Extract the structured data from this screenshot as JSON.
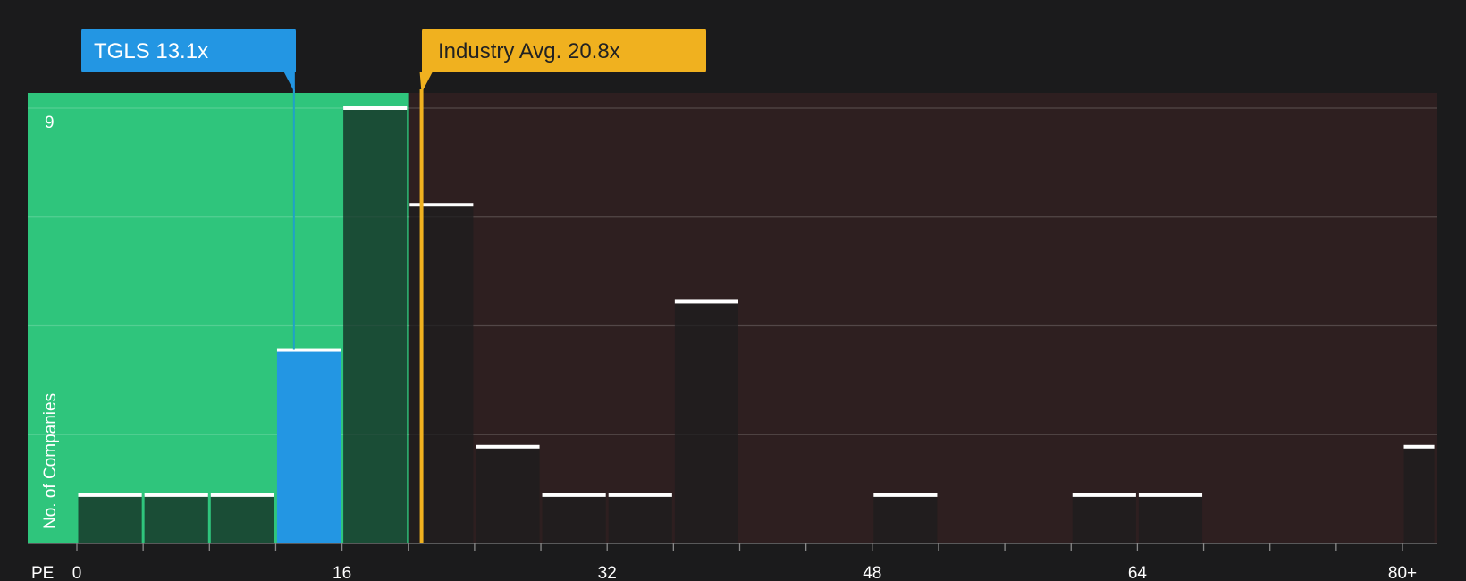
{
  "chart_data": {
    "type": "bar",
    "xlabel": "PE",
    "ylabel": "No. of Companies",
    "x_ticks": [
      "0",
      "16",
      "32",
      "48",
      "64",
      "80+"
    ],
    "x_tick_values": [
      0,
      16,
      32,
      48,
      64,
      80
    ],
    "xlim": [
      -3,
      82
    ],
    "ylim": [
      0,
      9.3
    ],
    "y_ticks": [
      9
    ],
    "y_tick_labels": [
      "9"
    ],
    "grid": true,
    "bins": [
      {
        "x0": 0,
        "x1": 4,
        "count": 1,
        "group": "below"
      },
      {
        "x0": 4,
        "x1": 8,
        "count": 1,
        "group": "below"
      },
      {
        "x0": 8,
        "x1": 12,
        "count": 1,
        "group": "below"
      },
      {
        "x0": 12,
        "x1": 16,
        "count": 4,
        "group": "company"
      },
      {
        "x0": 16,
        "x1": 20,
        "count": 9,
        "group": "below"
      },
      {
        "x0": 20,
        "x1": 24,
        "count": 7,
        "group": "above"
      },
      {
        "x0": 24,
        "x1": 28,
        "count": 2,
        "group": "above"
      },
      {
        "x0": 28,
        "x1": 32,
        "count": 1,
        "group": "above"
      },
      {
        "x0": 32,
        "x1": 36,
        "count": 1,
        "group": "above"
      },
      {
        "x0": 36,
        "x1": 40,
        "count": 5,
        "group": "above"
      },
      {
        "x0": 48,
        "x1": 52,
        "count": 1,
        "group": "above"
      },
      {
        "x0": 60,
        "x1": 64,
        "count": 1,
        "group": "above"
      },
      {
        "x0": 64,
        "x1": 68,
        "count": 1,
        "group": "above"
      },
      {
        "x0": 80,
        "x1": 82,
        "count": 2,
        "group": "above"
      }
    ],
    "green_zone_end": 20,
    "company": {
      "label": "TGLS 13.1x",
      "value": 13.1
    },
    "industry": {
      "label": "Industry Avg. 20.8x",
      "value": 20.8
    },
    "colors": {
      "background": "#1b1b1c",
      "below_zone": "#2fc57c",
      "above_zone": "#2e1f20",
      "company_bar": "#2396e3",
      "industry_line": "#f0b11f",
      "bar_cap": "#ffffff"
    }
  }
}
